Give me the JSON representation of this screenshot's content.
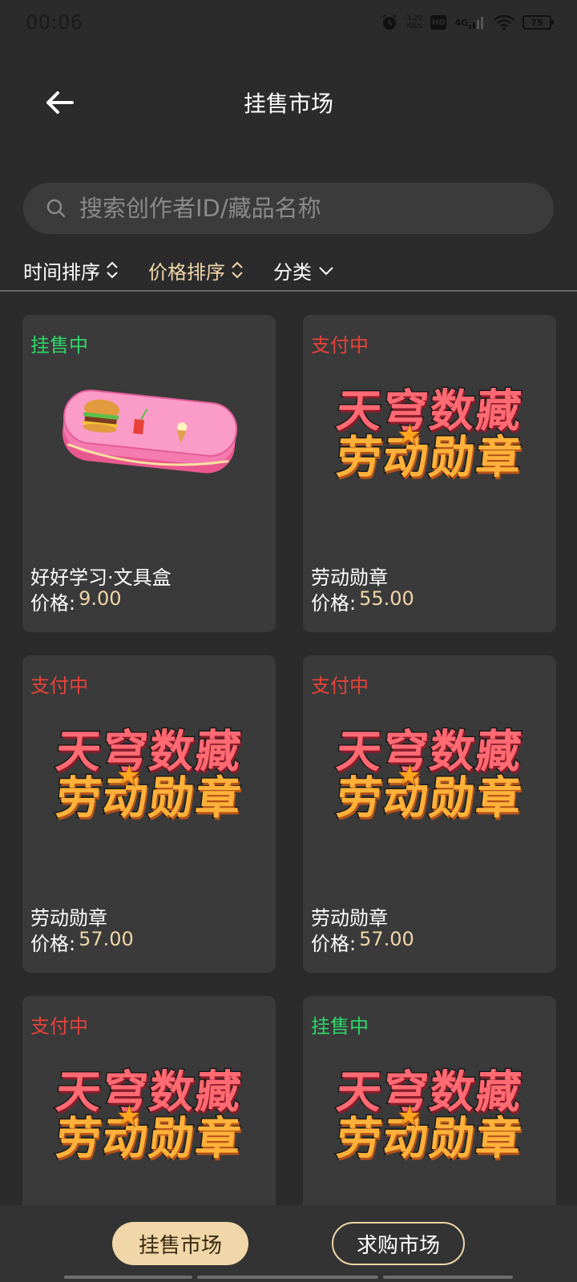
{
  "status_bar": {
    "time": "00:06",
    "speed_value": "3.20",
    "speed_unit": "KB/s",
    "hd": "HD",
    "network": "4G",
    "battery": "75",
    "icons": [
      "alarm-icon",
      "hd-icon",
      "signal-4g-icon",
      "wifi-icon",
      "battery-icon"
    ]
  },
  "header": {
    "title": "挂售市场",
    "back_icon": "arrow-left-icon"
  },
  "search": {
    "placeholder": "搜索创作者ID/藏品名称",
    "value": "",
    "icon": "search-icon"
  },
  "filters": [
    {
      "label": "时间排序",
      "type": "sort",
      "active": false
    },
    {
      "label": "价格排序",
      "type": "sort",
      "active": true
    },
    {
      "label": "分类",
      "type": "dropdown",
      "active": false
    }
  ],
  "price_label": "价格:",
  "badge_art": {
    "line1": "天穹数藏",
    "line2": "劳动勋章"
  },
  "items": [
    {
      "status": "挂售中",
      "status_color": "#2ed66b",
      "name": "好好学习·文具盒",
      "price": "9.00",
      "image": "pencil-case"
    },
    {
      "status": "支付中",
      "status_color": "#e8413a",
      "name": "劳动勋章",
      "price": "55.00",
      "image": "badge"
    },
    {
      "status": "支付中",
      "status_color": "#e8413a",
      "name": "劳动勋章",
      "price": "57.00",
      "image": "badge"
    },
    {
      "status": "支付中",
      "status_color": "#e8413a",
      "name": "劳动勋章",
      "price": "57.00",
      "image": "badge"
    },
    {
      "status": "支付中",
      "status_color": "#e8413a",
      "name": "",
      "price": "",
      "image": "badge"
    },
    {
      "status": "挂售中",
      "status_color": "#2ed66b",
      "name": "",
      "price": "",
      "image": "badge"
    }
  ],
  "bottom_nav": {
    "sell_market": "挂售市场",
    "buy_market": "求购市场"
  },
  "colors": {
    "background": "#2b2b2b",
    "card": "#3a3a3a",
    "accent": "#f0d6a8",
    "green": "#2ed66b",
    "red": "#e8413a"
  }
}
